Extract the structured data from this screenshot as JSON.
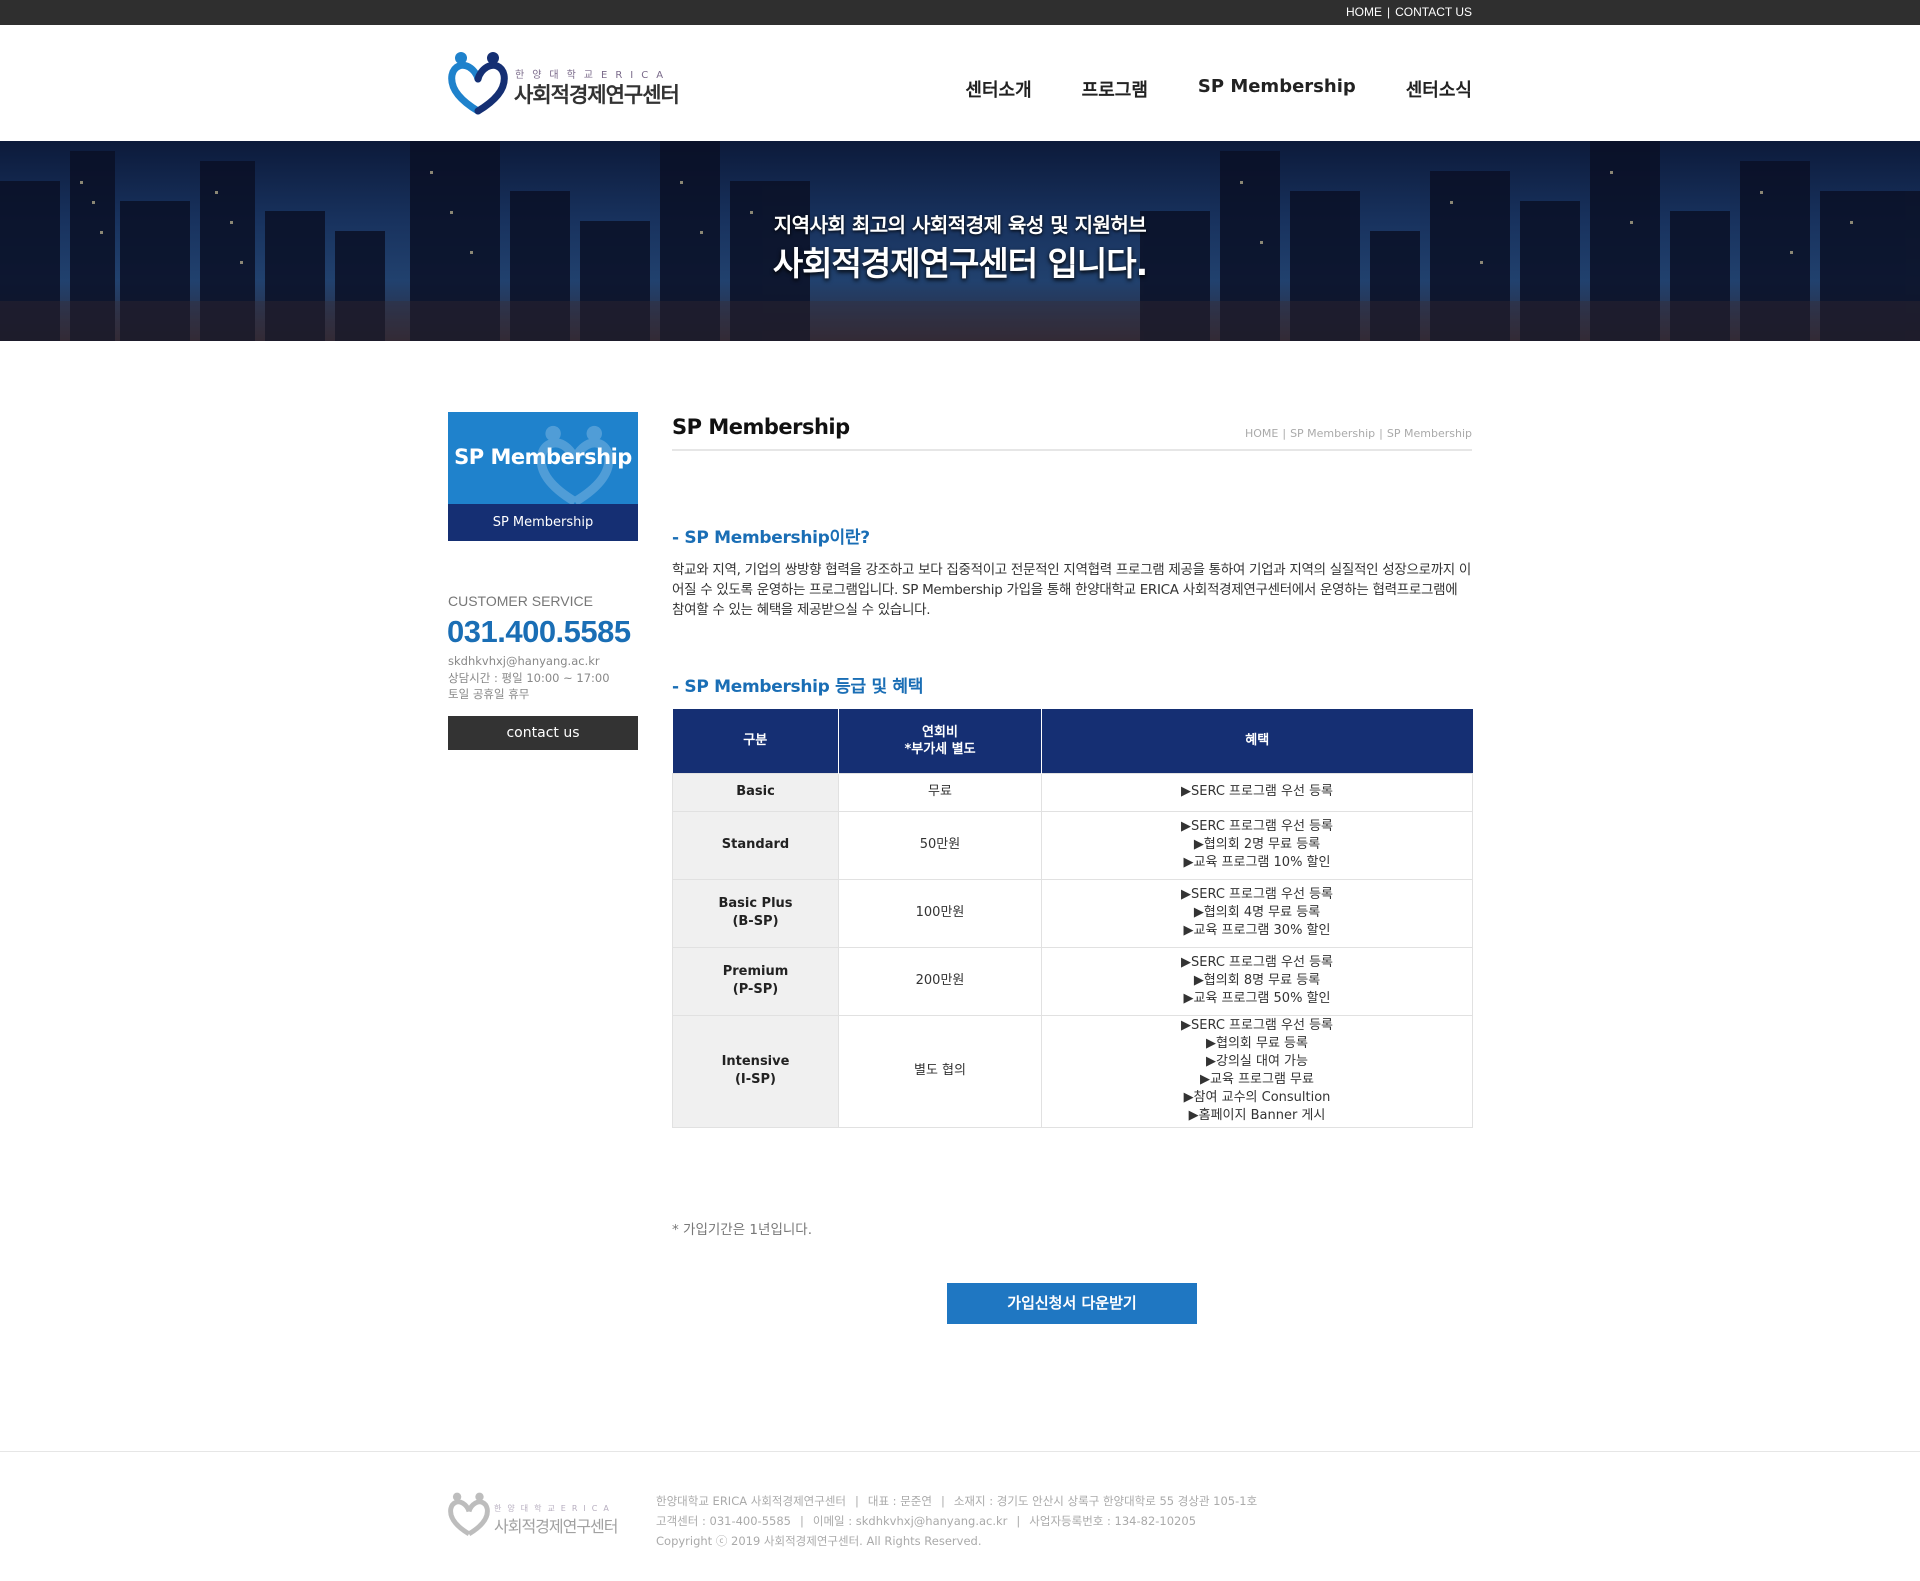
{
  "top_links": [
    "HOME",
    "CONTACT US"
  ],
  "logo": {
    "sub": "한양대학교ERICA",
    "main": "사회적경제연구센터"
  },
  "nav": [
    "센터소개",
    "프로그램",
    "SP Membership",
    "센터소식"
  ],
  "hero": {
    "line1": "지역사회 최고의 사회적경제 육성 및 지원허브",
    "line2": "사회적경제연구센터 입니다."
  },
  "sidebar": {
    "banner_title": "SP Membership",
    "banner_sub": "SP Membership",
    "cs_label": "CUSTOMER SERVICE",
    "phone": "031.400.5585",
    "email": "skdhkvhxj@hanyang.ac.kr",
    "hours": "상담시간 : 평일 10:00 ~ 17:00",
    "closed": "토일 공휴일 휴무",
    "contact_button": "contact us"
  },
  "content": {
    "page_title": "SP Membership",
    "breadcrumb": [
      "HOME",
      "SP Membership",
      "SP Membership"
    ],
    "section1_title": "- SP Membership이란?",
    "intro": "학교와 지역, 기업의 쌍방향 협력을 강조하고 보다 집중적이고 전문적인 지역협력 프로그램 제공을 통하여 기업과 지역의 실질적인 성장으로까지 이어질 수 있도록 운영하는 프로그램입니다. SP Membership 가입을 통해 한양대학교 ERICA 사회적경제연구센터에서 운영하는 협력프로그램에 참여할 수 있는 혜택을 제공받으실 수 있습니다.",
    "section2_title": "- SP Membership 등급 및 혜택",
    "table": {
      "headers": [
        "구분",
        "연회비",
        "*부가세 별도",
        "혜택"
      ],
      "rows": [
        {
          "grade": [
            "Basic"
          ],
          "fee": "무료",
          "benefits": [
            "▶SERC 프로그램 우선 등록"
          ]
        },
        {
          "grade": [
            "Standard"
          ],
          "fee": "50만원",
          "benefits": [
            "▶SERC 프로그램 우선 등록",
            "▶협의회 2명 무료 등록",
            "▶교육 프로그램 10% 할인"
          ]
        },
        {
          "grade": [
            "Basic Plus",
            "(B-SP)"
          ],
          "fee": "100만원",
          "benefits": [
            "▶SERC 프로그램 우선 등록",
            "▶협의회 4명 무료 등록",
            "▶교육 프로그램 30% 할인"
          ]
        },
        {
          "grade": [
            "Premium",
            "(P-SP)"
          ],
          "fee": "200만원",
          "benefits": [
            "▶SERC 프로그램 우선 등록",
            "▶협의회 8명 무료 등록",
            "▶교육 프로그램 50% 할인"
          ]
        },
        {
          "grade": [
            "Intensive",
            "(I-SP)"
          ],
          "fee": "별도 협의",
          "benefits": [
            "▶SERC 프로그램 우선 등록",
            "▶협의회 무료 등록",
            "▶강의실 대여 가능",
            "▶교육 프로그램 무료",
            "▶참여 교수의 Consultion",
            "▶홈페이지 Banner 게시"
          ]
        }
      ]
    },
    "note": "* 가입기간은 1년입니다.",
    "download_button": "가입신청서 다운받기"
  },
  "footer": {
    "line1": [
      "한양대학교 ERICA 사회적경제연구센터",
      "대표 : 문준연",
      "소재지 : 경기도 안산시 상록구 한양대학로 55 경상관 105-1호"
    ],
    "line2": [
      "고객센터 : 031-400-5585",
      "이메일 : skdhkvhxj@hanyang.ac.kr",
      "사업자등록번호 : 134-82-10205"
    ],
    "copyright": "Copyright ⓒ 2019 사회적경제연구센터. All Rights Reserved."
  },
  "colors": {
    "brand_blue": "#1f77c2",
    "navy": "#152f73",
    "topbar": "#2f2f2f"
  }
}
